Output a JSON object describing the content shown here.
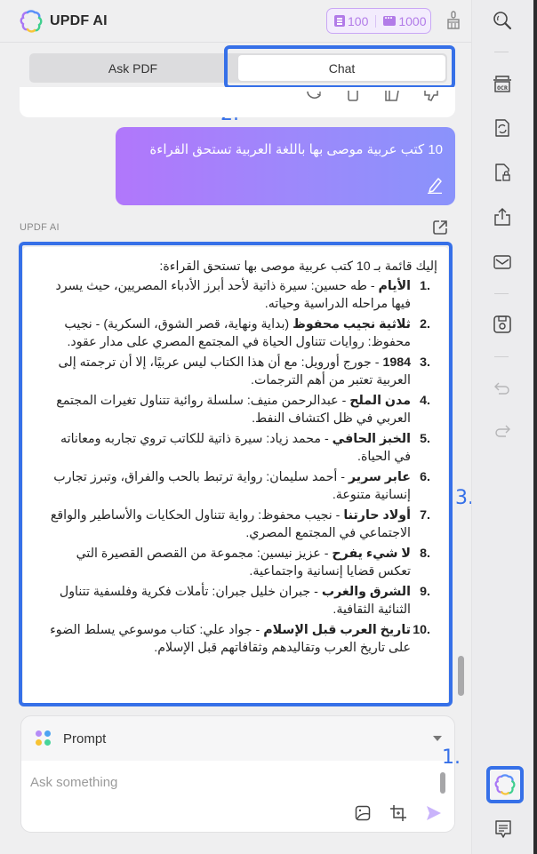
{
  "header": {
    "app_title": "UPDF AI",
    "quota_docs": "100",
    "quota_chats": "1000",
    "quota_doc_icon": "document-icon",
    "quota_chat_icon": "chat-bubble-icon",
    "clean_icon": "broom-icon"
  },
  "tabs": [
    {
      "label": "Ask PDF",
      "active": false
    },
    {
      "label": "Chat",
      "active": true
    }
  ],
  "annotations": {
    "one": "1.",
    "two": "2.",
    "three": "3."
  },
  "prev_message_actions": [
    "regenerate-icon",
    "copy-icon",
    "save-note-icon",
    "dislike-icon"
  ],
  "user_message": {
    "text": "10 كتب عربية موصى بها باللغة العربية تستحق القراءة",
    "edit_icon": "pencil-icon"
  },
  "ai_message": {
    "sender": "UPDF AI",
    "export_icon": "external-link-icon",
    "intro": "إليك قائمة بـ 10 كتب عربية موصى بها تستحق القراءة:",
    "items": [
      {
        "num": "1.",
        "title": "الأيام",
        "text": " - طه حسين: سيرة ذاتية لأحد أبرز الأدباء المصريين، حيث يسرد فيها مراحله الدراسية وحياته."
      },
      {
        "num": "2.",
        "title": "ثلاثية نجيب محفوظ",
        "text": " (بداية ونهاية، قصر الشوق، السكرية) - نجيب محفوظ: روايات تتناول الحياة في المجتمع المصري على مدار عقود."
      },
      {
        "num": "3.",
        "title": "1984",
        "text": " - جورج أورويل: مع أن هذا الكتاب ليس عربيًا، إلا أن ترجمته إلى العربية تعتبر من أهم الترجمات."
      },
      {
        "num": "4.",
        "title": "مدن الملح",
        "text": " - عبدالرحمن منيف: سلسلة روائية تتناول تغيرات المجتمع العربي في ظل اكتشاف النفط."
      },
      {
        "num": "5.",
        "title": "الخبز الحافي",
        "text": " - محمد زياد: سيرة ذاتية للكاتب تروي تجاربه ومعاناته في الحياة."
      },
      {
        "num": "6.",
        "title": "عابر سرير",
        "text": " - أحمد سليمان: رواية ترتبط بالحب والفراق، وتبرز تجارب إنسانية متنوعة."
      },
      {
        "num": "7.",
        "title": "أولاد حارتنا",
        "text": " - نجيب محفوظ: رواية تتناول الحكايات والأساطير والواقع الاجتماعي في المجتمع المصري."
      },
      {
        "num": "8.",
        "title": "لا شيء يفرح",
        "text": " - عزيز نيسين: مجموعة من القصص القصيرة التي تعكس قضايا إنسانية واجتماعية."
      },
      {
        "num": "9.",
        "title": "الشرق والغرب",
        "text": " - جبران خليل جبران: تأملات فكرية وفلسفية تتناول الثنائية الثقافية."
      },
      {
        "num": "10.",
        "title": "تاريخ العرب قبل الإسلام",
        "text": " - جواد علي: كتاب موسوعي يسلط الضوء على تاريخ العرب وتقاليدهم وثقافاتهم قبل الإسلام."
      }
    ]
  },
  "prompt": {
    "label": "Prompt",
    "placeholder": "Ask something",
    "value": "",
    "tools": [
      "image-upload-icon",
      "screenshot-crop-icon",
      "send-icon"
    ]
  },
  "sidebar": {
    "items": [
      "search-icon",
      "ocr-icon",
      "convert-icon",
      "protect-icon",
      "share-icon",
      "email-icon",
      "save-icon",
      "undo-icon",
      "redo-icon",
      "updf-ai-icon",
      "comment-icon"
    ]
  },
  "colors": {
    "accent": "#3670e8",
    "brand_purple": "#b27be8",
    "bubble_start": "#b177fb",
    "bubble_end": "#8a93fb"
  }
}
